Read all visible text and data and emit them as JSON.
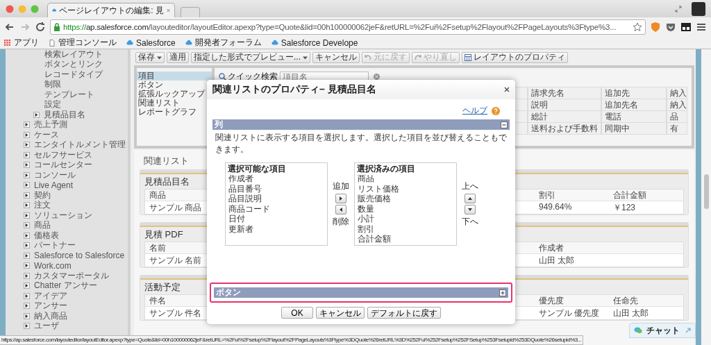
{
  "browser": {
    "tab_title": "ページレイアウトの編集: 見",
    "url_scheme": "https://",
    "url_host": "ap.salesforce.com",
    "url_path": "/layouteditor/layoutEditor.apexp?type=Quote&lid=00h100000062jeF&retURL=%2Fui%2Fsetup%2Flayout%2FPageLayouts%3Ftype%3...",
    "bookmarks": [
      {
        "label": "アプリ",
        "kind": "apps"
      },
      {
        "label": "管理コンソール",
        "kind": "page"
      },
      {
        "label": "Salesforce",
        "kind": "cloud"
      },
      {
        "label": "開発者フォーラム",
        "kind": "cloud"
      },
      {
        "label": "Salesforce Develope",
        "kind": "cloud"
      }
    ]
  },
  "sidebar": {
    "nested_items": [
      {
        "label": "検索レイアウト",
        "kind": "leaf"
      },
      {
        "label": "ボタンとリンク",
        "kind": "leaf"
      },
      {
        "label": "レコードタイプ",
        "kind": "leaf"
      },
      {
        "label": "制限",
        "kind": "leaf"
      },
      {
        "label": "テンプレート",
        "kind": "leaf"
      },
      {
        "label": "設定",
        "kind": "leaf"
      },
      {
        "label": "見積品目名",
        "kind": "folder",
        "expanded": false
      }
    ],
    "items": [
      {
        "label": "売上予測",
        "expanded": false
      },
      {
        "label": "ケース",
        "expanded": false
      },
      {
        "label": "エンタイトルメント管理",
        "expanded": false
      },
      {
        "label": "セルフサービス",
        "expanded": false
      },
      {
        "label": "コールセンター",
        "expanded": false
      },
      {
        "label": "コンソール",
        "expanded": false
      },
      {
        "label": "Live Agent",
        "expanded": false
      },
      {
        "label": "契約",
        "expanded": false
      },
      {
        "label": "注文",
        "expanded": false
      },
      {
        "label": "ソリューション",
        "expanded": false
      },
      {
        "label": "商品",
        "expanded": false
      },
      {
        "label": "価格表",
        "expanded": false
      },
      {
        "label": "パートナー",
        "expanded": false
      },
      {
        "label": "Salesforce to Salesforce",
        "expanded": false
      },
      {
        "label": "Work.com",
        "expanded": false
      },
      {
        "label": "カスタマーポータル",
        "expanded": false
      },
      {
        "label": "Chatter アンサー",
        "expanded": false
      },
      {
        "label": "アイデア",
        "expanded": false
      },
      {
        "label": "アンサー",
        "expanded": false
      },
      {
        "label": "納入商品",
        "expanded": false
      },
      {
        "label": "ユーザ",
        "expanded": false
      }
    ]
  },
  "toolbar": [
    {
      "label": "保存",
      "kind": "dropdown",
      "disabled": false
    },
    {
      "label": "適用",
      "kind": "plain",
      "disabled": false
    },
    {
      "label": "指定した形式でプレビュー...",
      "kind": "dropdown",
      "disabled": false
    },
    {
      "label": "キャンセル",
      "kind": "plain",
      "disabled": false
    },
    {
      "label": "元に戻す",
      "kind": "undo",
      "disabled": true
    },
    {
      "label": "やり直し",
      "kind": "redo",
      "disabled": true
    },
    {
      "label": "レイアウトのプロパティ",
      "kind": "properties",
      "disabled": false
    }
  ],
  "palette": {
    "categories": [
      {
        "label": "項目",
        "selected": true
      },
      {
        "label": "ボタン",
        "selected": false
      },
      {
        "label": "拡張ルックアップ",
        "selected": false
      },
      {
        "label": "関連リスト",
        "selected": false
      },
      {
        "label": "レポートグラフ",
        "selected": false
      }
    ],
    "quick_search": {
      "label": "クイック検索",
      "placeholder": "項目名"
    },
    "fields": [
      [
        "請求先名",
        "追加先",
        "納入"
      ],
      [
        "説明",
        "追加先名",
        "納入"
      ],
      [
        "総計",
        "電話",
        "品"
      ],
      [
        "送料および手数料",
        "同期中",
        "有"
      ]
    ]
  },
  "related_lists": {
    "heading": "関連リスト",
    "lists": [
      {
        "title": "見積品目名",
        "first_column": "商品",
        "first_value": "サンプル 商品",
        "columns": [
          "割引",
          "合計金額"
        ],
        "values": [
          "949.64%",
          "￥123"
        ]
      },
      {
        "title": "見積 PDF",
        "first_column": "名前",
        "first_value": "サンプル 名前",
        "columns": [
          "作成者"
        ],
        "values": [
          "山田 太郎"
        ]
      },
      {
        "title": "活動予定",
        "first_column": "件名",
        "first_value": "サンプル 件名",
        "columns": [
          "優先度",
          "任命先"
        ],
        "values": [
          "サンプル 優先度",
          "山田 太郎"
        ]
      }
    ]
  },
  "modal": {
    "title": "関連リストのプロパティ– 見積品目名",
    "help_link": "ヘルプ",
    "columns_section": {
      "title": "列",
      "expanded": true,
      "description": "関連リストに表示する項目を選択します。選択した項目を並び替えることもできます。",
      "available": {
        "legend": "選択可能な項目",
        "items": [
          "作成者",
          "品目番号",
          "品目説明",
          "商品コード",
          "日付",
          "更新者"
        ]
      },
      "chosen": {
        "legend": "選択済みの項目",
        "items": [
          "商品",
          "リスト価格",
          "販売価格",
          "数量",
          "小計",
          "割引",
          "合計金額"
        ]
      },
      "add_label": "追加",
      "remove_label": "削除",
      "up_label": "上へ",
      "down_label": "下へ"
    },
    "buttons_section": {
      "title": "ボタン",
      "expanded": false,
      "highlighted": true
    },
    "buttons": [
      "OK",
      "キャンセル",
      "デフォルトに戻す"
    ]
  },
  "chat": {
    "label": "チャット"
  },
  "status_url": "https://ap.salesforce.com/layouteditor/layoutEditor.apexp?type=Quote&lid=00h100000062jeF&retURL=%2Fui%2Fsetup%2Flayout%2FPageLayouts%3Ftype%3DQuote%26retURL%3D%252Fui%252Fsetup%252FSetup%253Fsetupid%253DQuote%26setupid%3..."
}
